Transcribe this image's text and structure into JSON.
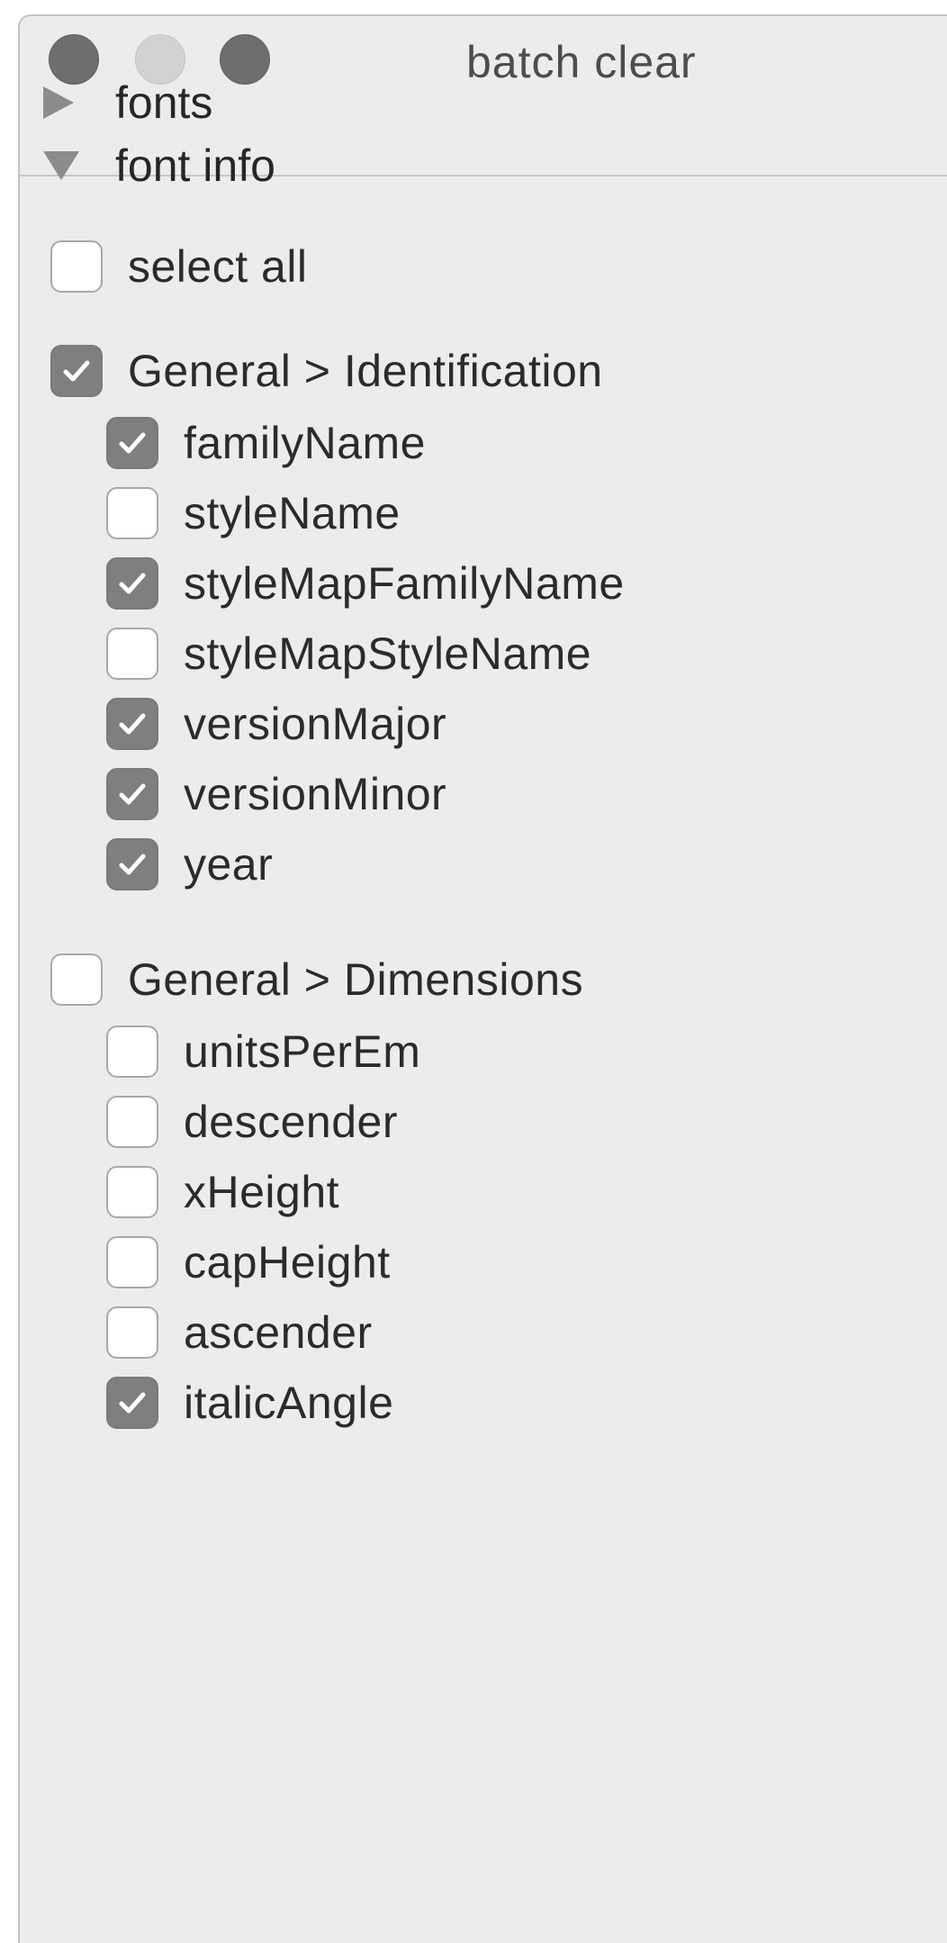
{
  "window": {
    "title": "batch clear"
  },
  "sections": {
    "fonts": {
      "label": "fonts",
      "expanded": false
    },
    "font_info": {
      "label": "font info",
      "expanded": true
    }
  },
  "select_all": {
    "label": "select all",
    "checked": false
  },
  "groups": [
    {
      "label": "General > Identification",
      "checked": true,
      "items": [
        {
          "label": "familyName",
          "checked": true
        },
        {
          "label": "styleName",
          "checked": false
        },
        {
          "label": "styleMapFamilyName",
          "checked": true
        },
        {
          "label": "styleMapStyleName",
          "checked": false
        },
        {
          "label": "versionMajor",
          "checked": true
        },
        {
          "label": "versionMinor",
          "checked": true
        },
        {
          "label": "year",
          "checked": true
        }
      ]
    },
    {
      "label": "General > Dimensions",
      "checked": false,
      "items": [
        {
          "label": "unitsPerEm",
          "checked": false
        },
        {
          "label": "descender",
          "checked": false
        },
        {
          "label": "xHeight",
          "checked": false
        },
        {
          "label": "capHeight",
          "checked": false
        },
        {
          "label": "ascender",
          "checked": false
        },
        {
          "label": "italicAngle",
          "checked": true
        }
      ]
    }
  ],
  "colors": {
    "window_bg": "#ececec",
    "checkbox_checked": "#7f7f7f",
    "checkbox_unchecked": "#ffffff",
    "disclosure_triangle": "#8c8c8c"
  },
  "icons": {
    "close": "traffic-light-close",
    "minimize": "traffic-light-minimize",
    "zoom": "traffic-light-zoom",
    "collapsed": "disclosure-right-triangle",
    "expanded": "disclosure-down-triangle",
    "check": "checkmark"
  }
}
